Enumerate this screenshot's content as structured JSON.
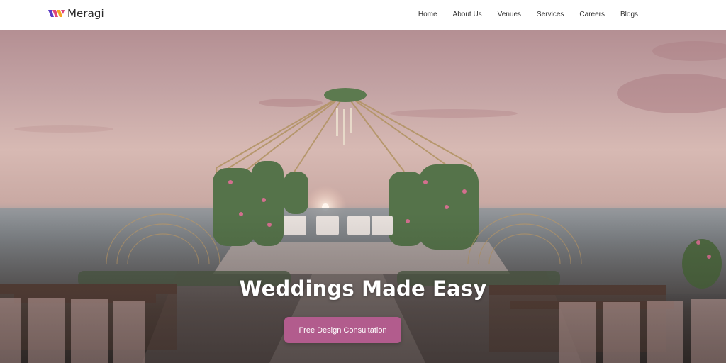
{
  "brand": {
    "name": "Meragi",
    "logo_colors": [
      "#5b3cc4",
      "#e0457b",
      "#f5a623"
    ]
  },
  "nav": {
    "items": [
      {
        "label": "Home"
      },
      {
        "label": "About Us"
      },
      {
        "label": "Venues"
      },
      {
        "label": "Services"
      },
      {
        "label": "Careers"
      },
      {
        "label": "Blogs"
      }
    ]
  },
  "hero": {
    "title": "Weddings Made Easy",
    "cta_label": "Free Design Consultation",
    "cta_color": "#b25c8d"
  }
}
